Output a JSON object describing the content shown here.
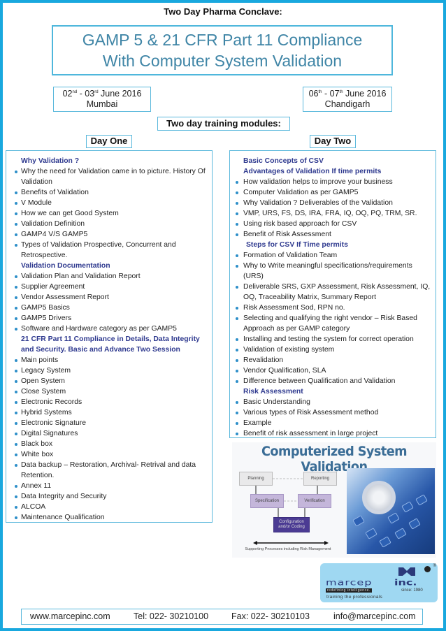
{
  "header": {
    "conclave": "Two Day Pharma Conclave:",
    "title_line1": "GAMP 5 & 21 CFR Part 11 Compliance",
    "title_line2": "With Computer System Validation"
  },
  "locations": [
    {
      "date_day1": "02",
      "sup1": "nd",
      "sep": " - ",
      "date_day2": "03",
      "sup2": "rd",
      "month_year": " June 2016",
      "city": "Mumbai"
    },
    {
      "date_day1": "06",
      "sup1": "th",
      "sep": " - ",
      "date_day2": "07",
      "sup2": "th",
      "month_year": " June 2016",
      "city": "Chandigarh"
    }
  ],
  "modules_label": "Two day training modules:",
  "day_one": {
    "label": "Day One",
    "rows": [
      {
        "type": "head",
        "text": "Why Validation ?"
      },
      {
        "type": "item",
        "text": "Why the need for Validation came in to picture. History Of Validation"
      },
      {
        "type": "item",
        "text": "Benefits of Validation"
      },
      {
        "type": "item",
        "text": "V Module"
      },
      {
        "type": "item",
        "text": "How we can get Good System"
      },
      {
        "type": "item",
        "text": "Validation Definition"
      },
      {
        "type": "item",
        "text": "GAMP4 V/S GAMP5"
      },
      {
        "type": "item",
        "text": "Types of Validation Prospective, Concurrent and Retrospective."
      },
      {
        "type": "head",
        "text": "Validation Documentation"
      },
      {
        "type": "item",
        "text": "Validation Plan and Validation Report"
      },
      {
        "type": "item",
        "text": "Supplier Agreement"
      },
      {
        "type": "item",
        "text": "Vendor Assessment Report"
      },
      {
        "type": "item",
        "text": "GAMP5  Basics"
      },
      {
        "type": "item",
        "text": "GAMP5 Drivers"
      },
      {
        "type": "item",
        "text": "Software and Hardware category as per GAMP5"
      },
      {
        "type": "head",
        "text": "21 CFR Part 11 Compliance in Details, Data Integrity and Security. Basic and Advance Two Session"
      },
      {
        "type": "item",
        "text": "Main points"
      },
      {
        "type": "item",
        "text": "Legacy System"
      },
      {
        "type": "item",
        "text": "Open System"
      },
      {
        "type": "item",
        "text": "Close System"
      },
      {
        "type": "item",
        "text": "Electronic Records"
      },
      {
        "type": "item",
        "text": "Hybrid Systems"
      },
      {
        "type": "item",
        "text": "Electronic Signature"
      },
      {
        "type": "item",
        "text": "Digital Signatures"
      },
      {
        "type": "item",
        "text": "Black box"
      },
      {
        "type": "item",
        "text": "White box"
      },
      {
        "type": "item",
        "text": "Data backup – Restoration, Archival- Retrival and data Retention."
      },
      {
        "type": "item",
        "text": "Annex 11"
      },
      {
        "type": "item",
        "text": "Data Integrity and Security"
      },
      {
        "type": "item",
        "text": "ALCOA"
      },
      {
        "type": "item",
        "text": "Maintenance Qualification"
      }
    ]
  },
  "day_two": {
    "label": "Day Two",
    "rows": [
      {
        "type": "head",
        "text": "Basic Concepts of CSV"
      },
      {
        "type": "head",
        "text": "Advantages of Validation  If time permits"
      },
      {
        "type": "item",
        "text": "How validation helps to improve your business"
      },
      {
        "type": "item",
        "text": "Computer Validation as per GAMP5"
      },
      {
        "type": "item",
        "text": "Why Validation ?  Deliverables of the Validation"
      },
      {
        "type": "item",
        "text": "VMP, URS, FS, DS, IRA, FRA, IQ, OQ, PQ, TRM, SR."
      },
      {
        "type": "item",
        "text": "Using risk based approach for CSV"
      },
      {
        "type": "item",
        "text": "Benefit of Risk Assessment"
      },
      {
        "type": "head-indent",
        "text": "Steps for CSV  If Time permits"
      },
      {
        "type": "item",
        "text": "Formation of Validation Team"
      },
      {
        "type": "item",
        "text": "Why to Write meaningful specifications/requirements (URS)"
      },
      {
        "type": "item",
        "text": "Deliverable SRS, GXP Assessment, Risk Assessment, IQ, OQ, Traceability Matrix, Summary Report"
      },
      {
        "type": "item",
        "text": "Risk Assessment Sod, RPN no."
      },
      {
        "type": "item",
        "text": "Selecting and qualifying the right vendor – Risk Based Approach as per GAMP category"
      },
      {
        "type": "item",
        "text": "Installing and testing the system for correct operation"
      },
      {
        "type": "item",
        "text": "Validation of existing system"
      },
      {
        "type": "item",
        "text": "Revalidation"
      },
      {
        "type": "item",
        "text": "Vendor Qualification, SLA"
      },
      {
        "type": "item",
        "text": "Difference between Qualification and Validation"
      },
      {
        "type": "head",
        "text": "Risk Assessment"
      },
      {
        "type": "item",
        "text": "Basic Understanding"
      },
      {
        "type": "item",
        "text": "Various types of Risk Assessment method"
      },
      {
        "type": "item",
        "text": "Example"
      },
      {
        "type": "item",
        "text": "Benefit of risk assessment in large project"
      }
    ]
  },
  "csv_image": {
    "title": "Computerized System Validation",
    "boxes": {
      "planning": "Planning",
      "reporting": "Reporting",
      "specification": "Specification",
      "verification": "Verification",
      "configuration": "Configuration and/or Coding"
    },
    "caption": "Supporting Processes including Risk Management"
  },
  "logo": {
    "word": "marcep",
    "inc": "inc.",
    "tagline": "redefining intelligence.",
    "since": "since: 1980",
    "training": "training the professionals",
    "reg": "®"
  },
  "footer": {
    "website": "www.marcepinc.com",
    "tel": "Tel: 022- 30210100",
    "fax": "Fax: 022- 30210103",
    "email": "info@marcepinc.com"
  },
  "colors": {
    "frame": "#19a8de",
    "box_border": "#5ab8dc",
    "title_text": "#3f85a6",
    "heading_text": "#2f3a8f",
    "bullet": "#2d8fc9"
  }
}
